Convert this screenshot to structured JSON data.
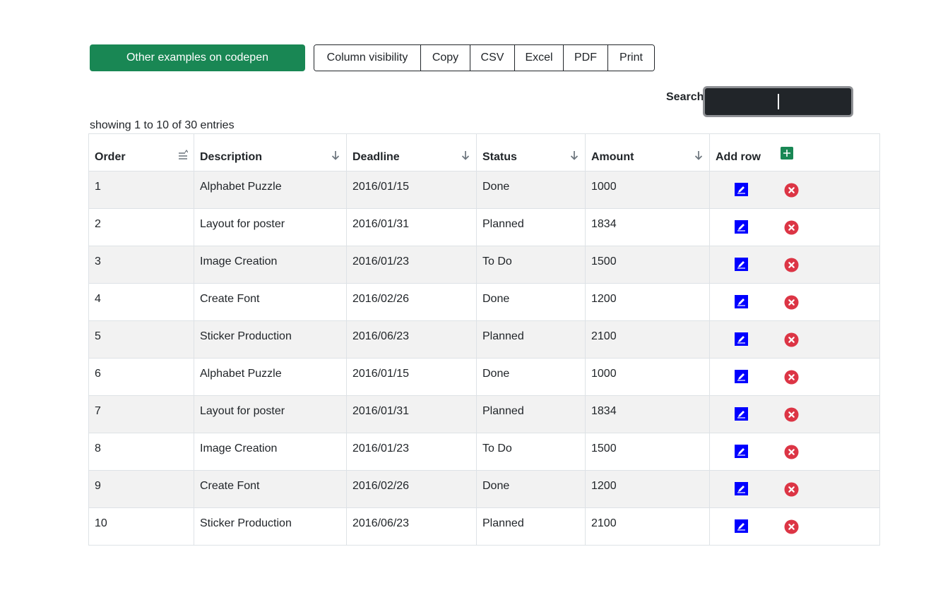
{
  "toolbar": {
    "codepen_label": "Other examples on codepen",
    "buttons": [
      "Column visibility",
      "Copy",
      "CSV",
      "Excel",
      "PDF",
      "Print"
    ]
  },
  "search": {
    "label": "Search:",
    "value": "",
    "placeholder": ""
  },
  "info": "showing 1 to 10 of 30 entries",
  "table": {
    "headers": [
      "Order",
      "Description",
      "Deadline",
      "Status",
      "Amount",
      "Add row"
    ],
    "rows": [
      [
        "1",
        "Alphabet Puzzle",
        "2016/01/15",
        "Done",
        "1000"
      ],
      [
        "2",
        "Layout for poster",
        "2016/01/31",
        "Planned",
        "1834"
      ],
      [
        "3",
        "Image Creation",
        "2016/01/23",
        "To Do",
        "1500"
      ],
      [
        "4",
        "Create Font",
        "2016/02/26",
        "Done",
        "1200"
      ],
      [
        "5",
        "Sticker Production",
        "2016/06/23",
        "Planned",
        "2100"
      ],
      [
        "6",
        "Alphabet Puzzle",
        "2016/01/15",
        "Done",
        "1000"
      ],
      [
        "7",
        "Layout for poster",
        "2016/01/31",
        "Planned",
        "1834"
      ],
      [
        "8",
        "Image Creation",
        "2016/01/23",
        "To Do",
        "1500"
      ],
      [
        "9",
        "Create Font",
        "2016/02/26",
        "Done",
        "1200"
      ],
      [
        "10",
        "Sticker Production",
        "2016/06/23",
        "Planned",
        "2100"
      ]
    ]
  },
  "icons": {
    "order_sort": "sort-lines-icon",
    "column_sort": "arrow-down-icon",
    "add": "plus-icon",
    "edit": "edit-icon",
    "delete": "close-circle-icon"
  },
  "colors": {
    "primary_green": "#198754",
    "edit_blue": "#0000ff",
    "delete_red": "#dc3545",
    "search_bg": "#212529",
    "striped_row": "#f2f2f2"
  }
}
